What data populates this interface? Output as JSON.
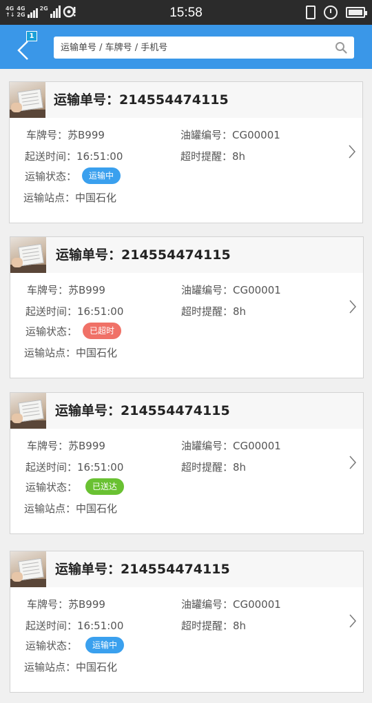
{
  "status_bar": {
    "net1": "4G",
    "net1_sub": "↑↓",
    "net2": "4G",
    "net2_sub": "2G",
    "net3": "2G",
    "time": "15:58"
  },
  "header": {
    "back_badge": "1",
    "search_placeholder": "运输单号 / 车牌号 / 手机号"
  },
  "colors": {
    "header": "#3a97e8",
    "status_in_transit": "#3aa0ee",
    "status_timeout": "#f07167",
    "status_delivered": "#69c132"
  },
  "orders": [
    {
      "title_label": "运输单号：",
      "order_no": "214554474115",
      "plate": "车牌号：苏B999",
      "tank": "油罐编号：CG00001",
      "send_time": "起送时间：16:51:00",
      "timeout": "超时提醒：8h",
      "status_label": "运输状态：",
      "status": "运输中",
      "status_color": "#3aa0ee",
      "station": "运输站点：中国石化"
    },
    {
      "title_label": "运输单号：",
      "order_no": "214554474115",
      "plate": "车牌号：苏B999",
      "tank": "油罐编号：CG00001",
      "send_time": "起送时间：16:51:00",
      "timeout": "超时提醒：8h",
      "status_label": "运输状态：",
      "status": "已超时",
      "status_color": "#f07167",
      "station": "运输站点：中国石化"
    },
    {
      "title_label": "运输单号：",
      "order_no": "214554474115",
      "plate": "车牌号：苏B999",
      "tank": "油罐编号：CG00001",
      "send_time": "起送时间：16:51:00",
      "timeout": "超时提醒：8h",
      "status_label": "运输状态：",
      "status": "已送达",
      "status_color": "#69c132",
      "station": "运输站点：中国石化"
    },
    {
      "title_label": "运输单号：",
      "order_no": "214554474115",
      "plate": "车牌号：苏B999",
      "tank": "油罐编号：CG00001",
      "send_time": "起送时间：16:51:00",
      "timeout": "超时提醒：8h",
      "status_label": "运输状态：",
      "status": "运输中",
      "status_color": "#3aa0ee",
      "station": "运输站点：中国石化"
    }
  ]
}
